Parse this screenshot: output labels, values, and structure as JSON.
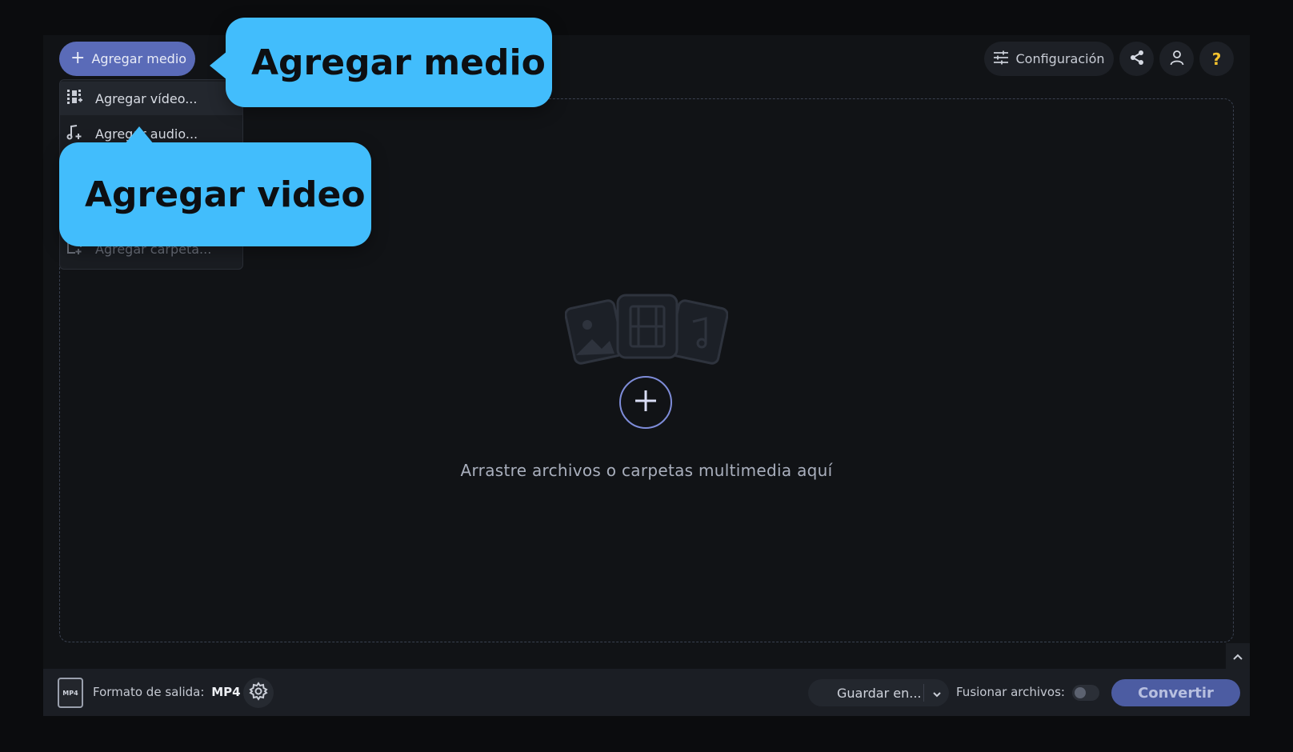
{
  "toolbar": {
    "add_media_label": "Agregar medio",
    "settings_label": "Configuración",
    "help_label": "?"
  },
  "dropdown": {
    "items": [
      {
        "label": "Agregar vídeo...",
        "icon": "add-video-icon"
      },
      {
        "label": "Agregar audio...",
        "icon": "add-audio-icon"
      },
      {
        "label": "Agregar carpeta...",
        "icon": "add-folder-icon"
      }
    ]
  },
  "dropzone": {
    "message": "Arrastre archivos o carpetas multimedia aquí"
  },
  "callouts": {
    "add_media": "Agregar medio",
    "add_video": "Agregar video"
  },
  "bottom": {
    "format_label": "Formato de salida:",
    "format_value": "MP4",
    "format_icon_text": "MP4",
    "save_label": "Guardar en...",
    "merge_label": "Fusionar archivos:",
    "convert_label": "Convertir"
  },
  "colors": {
    "accent": "#5a6bb8",
    "callout": "#42bdfc",
    "help": "#f2c12e",
    "background": "#111316"
  }
}
